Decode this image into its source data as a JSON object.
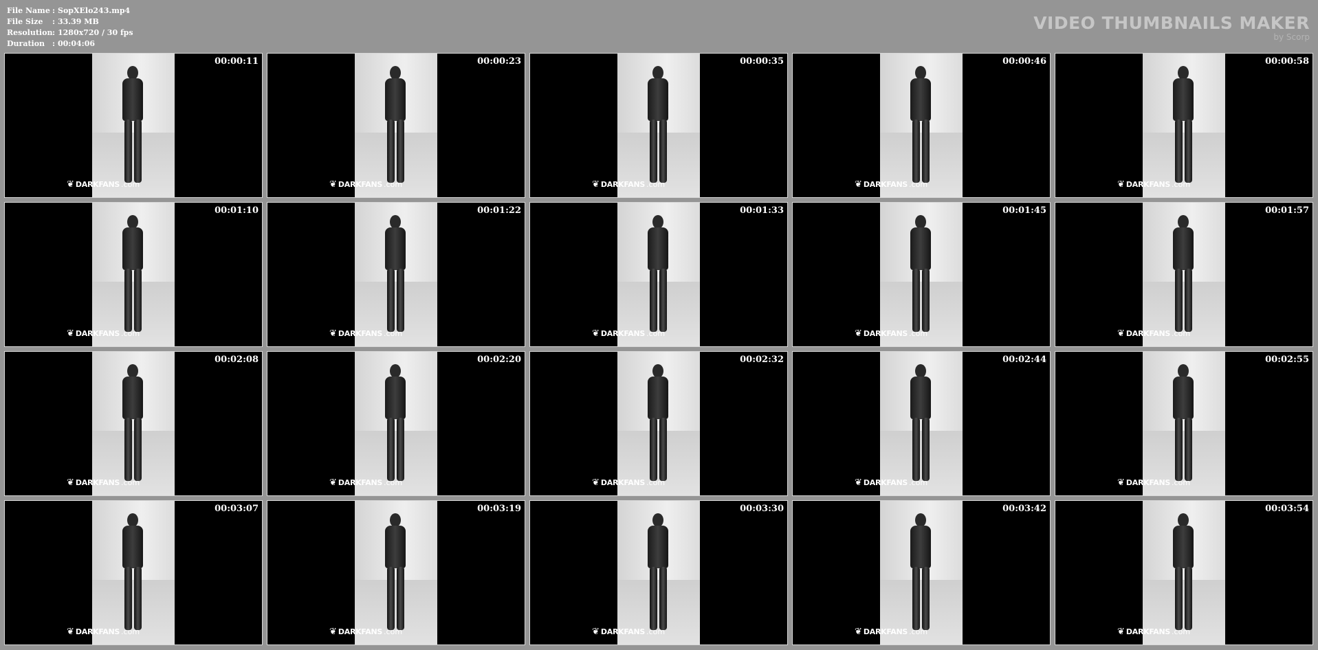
{
  "info": {
    "rows": [
      {
        "label": "File Name",
        "value": "SopXElo243.mp4"
      },
      {
        "label": "File Size",
        "value": "33.39 MB"
      },
      {
        "label": "Resolution",
        "value": "1280x720 / 30 fps"
      },
      {
        "label": "Duration",
        "value": "00:04:06"
      }
    ]
  },
  "brand": {
    "title": "VIDEO THUMBNAILS MAKER",
    "subtitle": "by Scorp"
  },
  "watermark": {
    "logo_icon": "darkfans-logo-icon",
    "strong": "DARKFANS",
    "suffix": ".com"
  },
  "thumbnails": [
    {
      "time": "00:00:11"
    },
    {
      "time": "00:00:23"
    },
    {
      "time": "00:00:35"
    },
    {
      "time": "00:00:46"
    },
    {
      "time": "00:00:58"
    },
    {
      "time": "00:01:10"
    },
    {
      "time": "00:01:22"
    },
    {
      "time": "00:01:33"
    },
    {
      "time": "00:01:45"
    },
    {
      "time": "00:01:57"
    },
    {
      "time": "00:02:08"
    },
    {
      "time": "00:02:20"
    },
    {
      "time": "00:02:32"
    },
    {
      "time": "00:02:44"
    },
    {
      "time": "00:02:55"
    },
    {
      "time": "00:03:07"
    },
    {
      "time": "00:03:19"
    },
    {
      "time": "00:03:30"
    },
    {
      "time": "00:03:42"
    },
    {
      "time": "00:03:54"
    }
  ]
}
